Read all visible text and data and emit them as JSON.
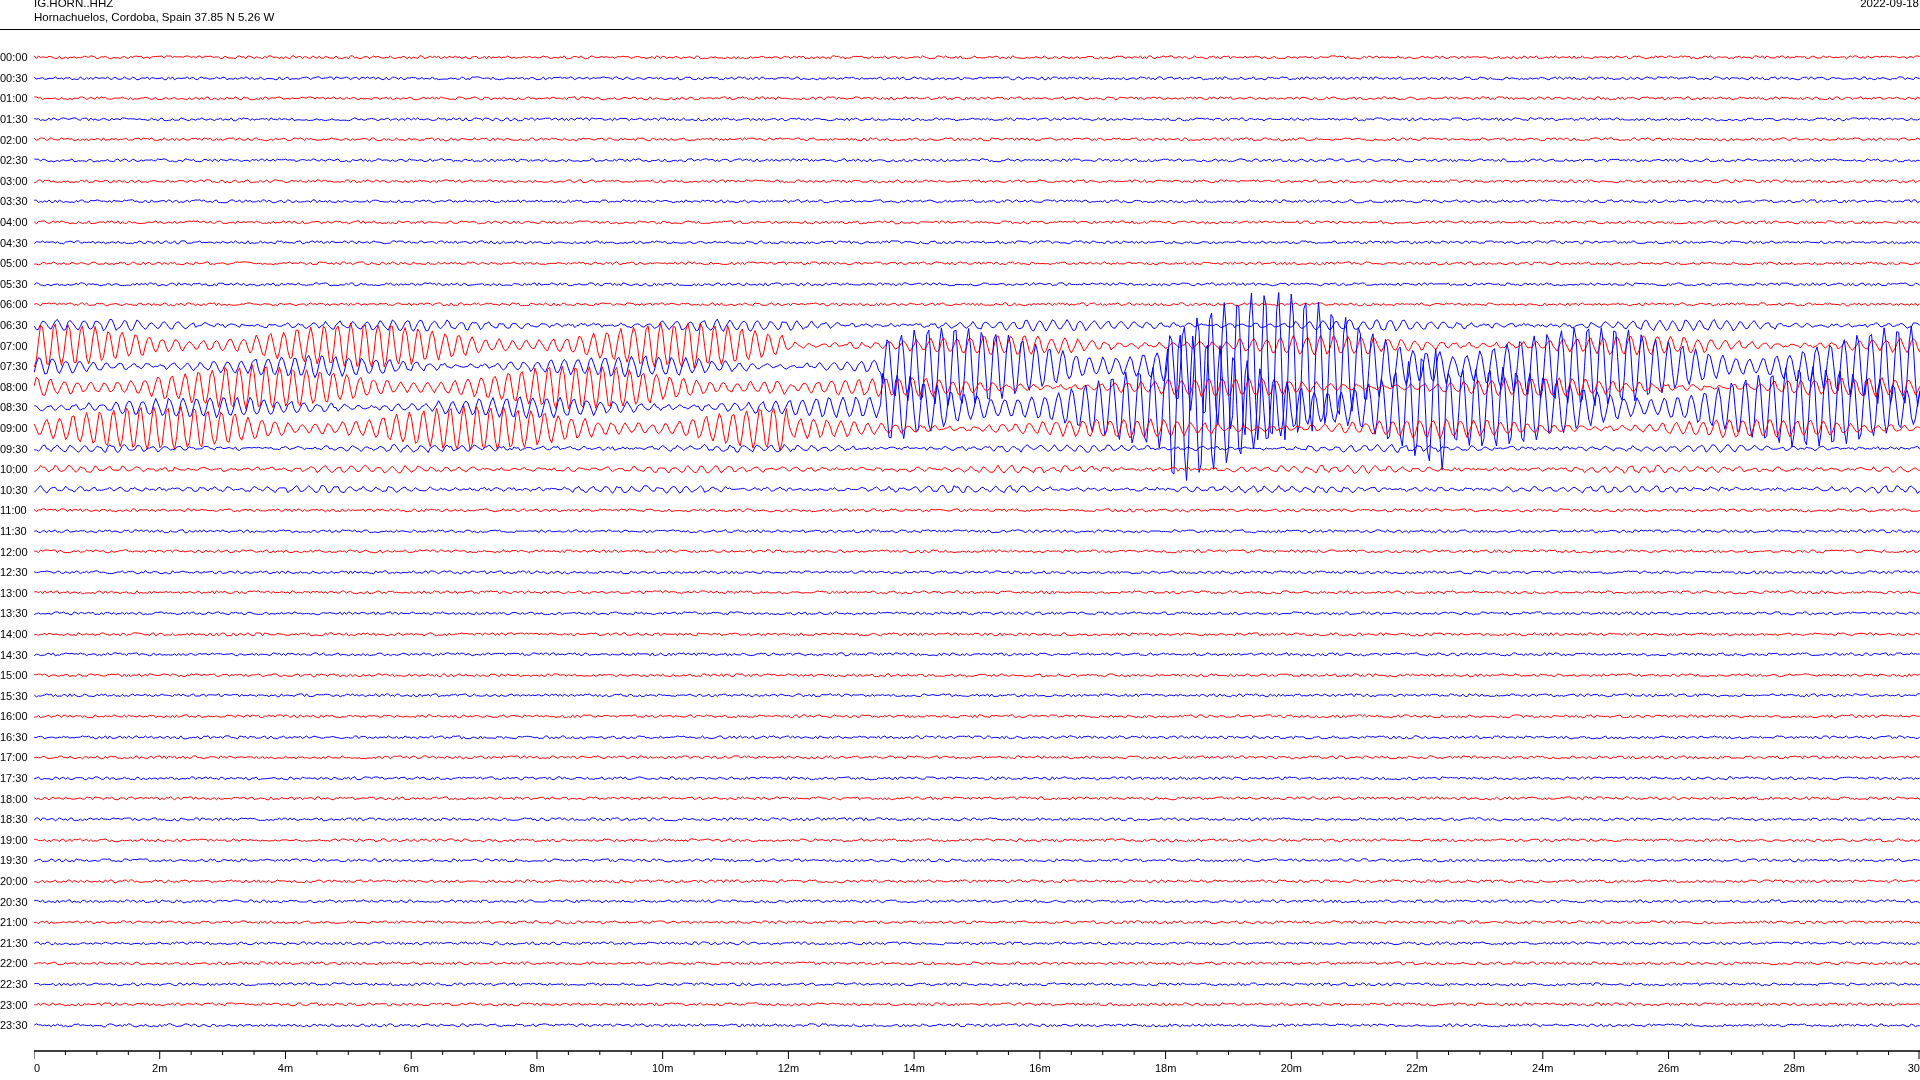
{
  "header": {
    "station": "IG.HORN..HHZ",
    "location": "Hornachuelos, Cordoba, Spain  37.85 N 5.26 W",
    "date": "2022-09-18"
  },
  "rows": [
    {
      "time": "00:00",
      "color": "#ff0000"
    },
    {
      "time": "00:30",
      "color": "#0000ff"
    },
    {
      "time": "01:00",
      "color": "#ff0000"
    },
    {
      "time": "01:30",
      "color": "#0000ff"
    },
    {
      "time": "02:00",
      "color": "#ff0000"
    },
    {
      "time": "02:30",
      "color": "#0000ff"
    },
    {
      "time": "03:00",
      "color": "#ff0000"
    },
    {
      "time": "03:30",
      "color": "#0000ff"
    },
    {
      "time": "04:00",
      "color": "#ff0000"
    },
    {
      "time": "04:30",
      "color": "#0000ff"
    },
    {
      "time": "05:00",
      "color": "#ff0000"
    },
    {
      "time": "05:30",
      "color": "#0000ff"
    },
    {
      "time": "06:00",
      "color": "#ff0000"
    },
    {
      "time": "06:30",
      "color": "#0000ff"
    },
    {
      "time": "07:00",
      "color": "#ff0000"
    },
    {
      "time": "07:30",
      "color": "#0000ff"
    },
    {
      "time": "08:00",
      "color": "#ff0000"
    },
    {
      "time": "08:30",
      "color": "#0000ff"
    },
    {
      "time": "09:00",
      "color": "#ff0000"
    },
    {
      "time": "09:30",
      "color": "#0000ff"
    },
    {
      "time": "10:00",
      "color": "#ff0000"
    },
    {
      "time": "10:30",
      "color": "#0000ff"
    },
    {
      "time": "11:00",
      "color": "#ff0000"
    },
    {
      "time": "11:30",
      "color": "#0000ff"
    },
    {
      "time": "12:00",
      "color": "#ff0000"
    },
    {
      "time": "12:30",
      "color": "#0000ff"
    },
    {
      "time": "13:00",
      "color": "#ff0000"
    },
    {
      "time": "13:30",
      "color": "#0000ff"
    },
    {
      "time": "14:00",
      "color": "#ff0000"
    },
    {
      "time": "14:30",
      "color": "#0000ff"
    },
    {
      "time": "15:00",
      "color": "#ff0000"
    },
    {
      "time": "15:30",
      "color": "#0000ff"
    },
    {
      "time": "16:00",
      "color": "#ff0000"
    },
    {
      "time": "16:30",
      "color": "#0000ff"
    },
    {
      "time": "17:00",
      "color": "#ff0000"
    },
    {
      "time": "17:30",
      "color": "#0000ff"
    },
    {
      "time": "18:00",
      "color": "#ff0000"
    },
    {
      "time": "18:30",
      "color": "#0000ff"
    },
    {
      "time": "19:00",
      "color": "#ff0000"
    },
    {
      "time": "19:30",
      "color": "#0000ff"
    },
    {
      "time": "20:00",
      "color": "#ff0000"
    },
    {
      "time": "20:30",
      "color": "#0000ff"
    },
    {
      "time": "21:00",
      "color": "#ff0000"
    },
    {
      "time": "21:30",
      "color": "#0000ff"
    },
    {
      "time": "22:00",
      "color": "#ff0000"
    },
    {
      "time": "22:30",
      "color": "#0000ff"
    },
    {
      "time": "23:00",
      "color": "#ff0000"
    },
    {
      "time": "23:30",
      "color": "#0000ff"
    }
  ],
  "x_axis": {
    "labels": [
      "0",
      "2m",
      "4m",
      "6m",
      "8m",
      "10m",
      "12m",
      "14m",
      "16m",
      "18m",
      "20m",
      "22m",
      "24m",
      "26m",
      "28m",
      "30"
    ]
  }
}
